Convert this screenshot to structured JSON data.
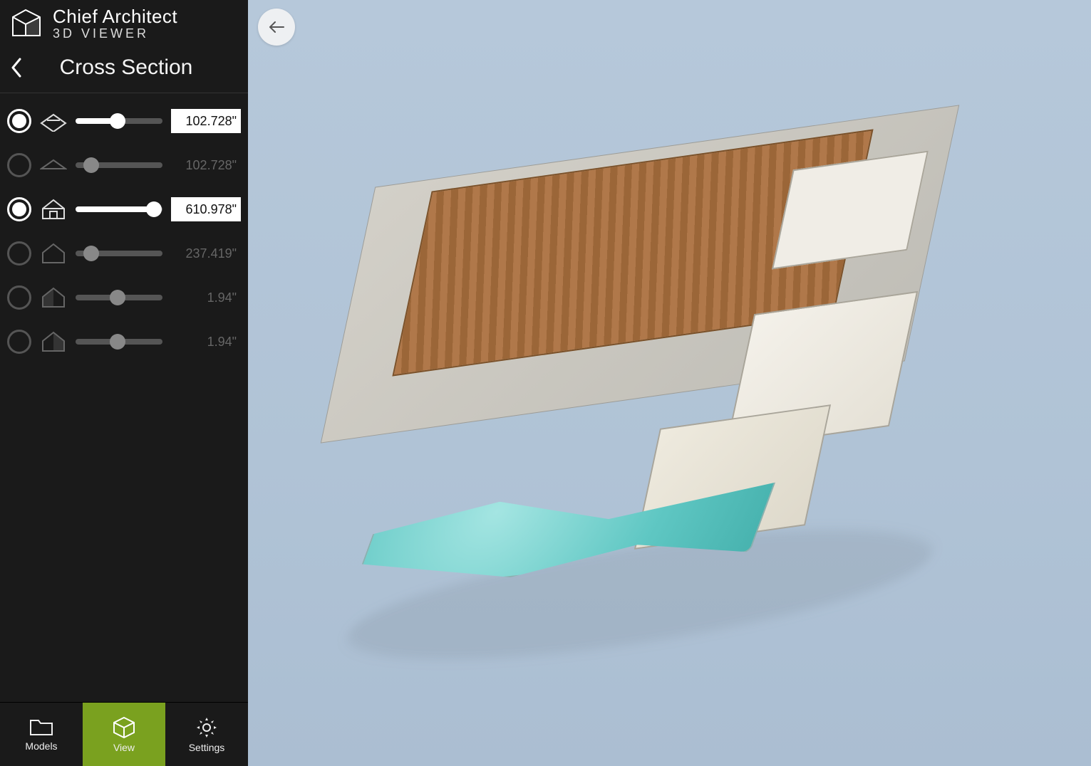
{
  "app": {
    "brand_line1": "Chief Architect",
    "brand_line2": "3D VIEWER"
  },
  "panel": {
    "title": "Cross Section"
  },
  "sections": [
    {
      "active": true,
      "value": "102.728\"",
      "slider_pct": 48,
      "icon": "roof-top"
    },
    {
      "active": false,
      "value": "102.728\"",
      "slider_pct": 18,
      "icon": "roof-simple"
    },
    {
      "active": true,
      "value": "610.978\"",
      "slider_pct": 90,
      "icon": "house-open"
    },
    {
      "active": false,
      "value": "237.419\"",
      "slider_pct": 18,
      "icon": "house-outline"
    },
    {
      "active": false,
      "value": "1.94\"",
      "slider_pct": 48,
      "icon": "house-shaded-left"
    },
    {
      "active": false,
      "value": "1.94\"",
      "slider_pct": 48,
      "icon": "house-shaded-right"
    }
  ],
  "nav": {
    "models": "Models",
    "view": "View",
    "settings": "Settings"
  }
}
